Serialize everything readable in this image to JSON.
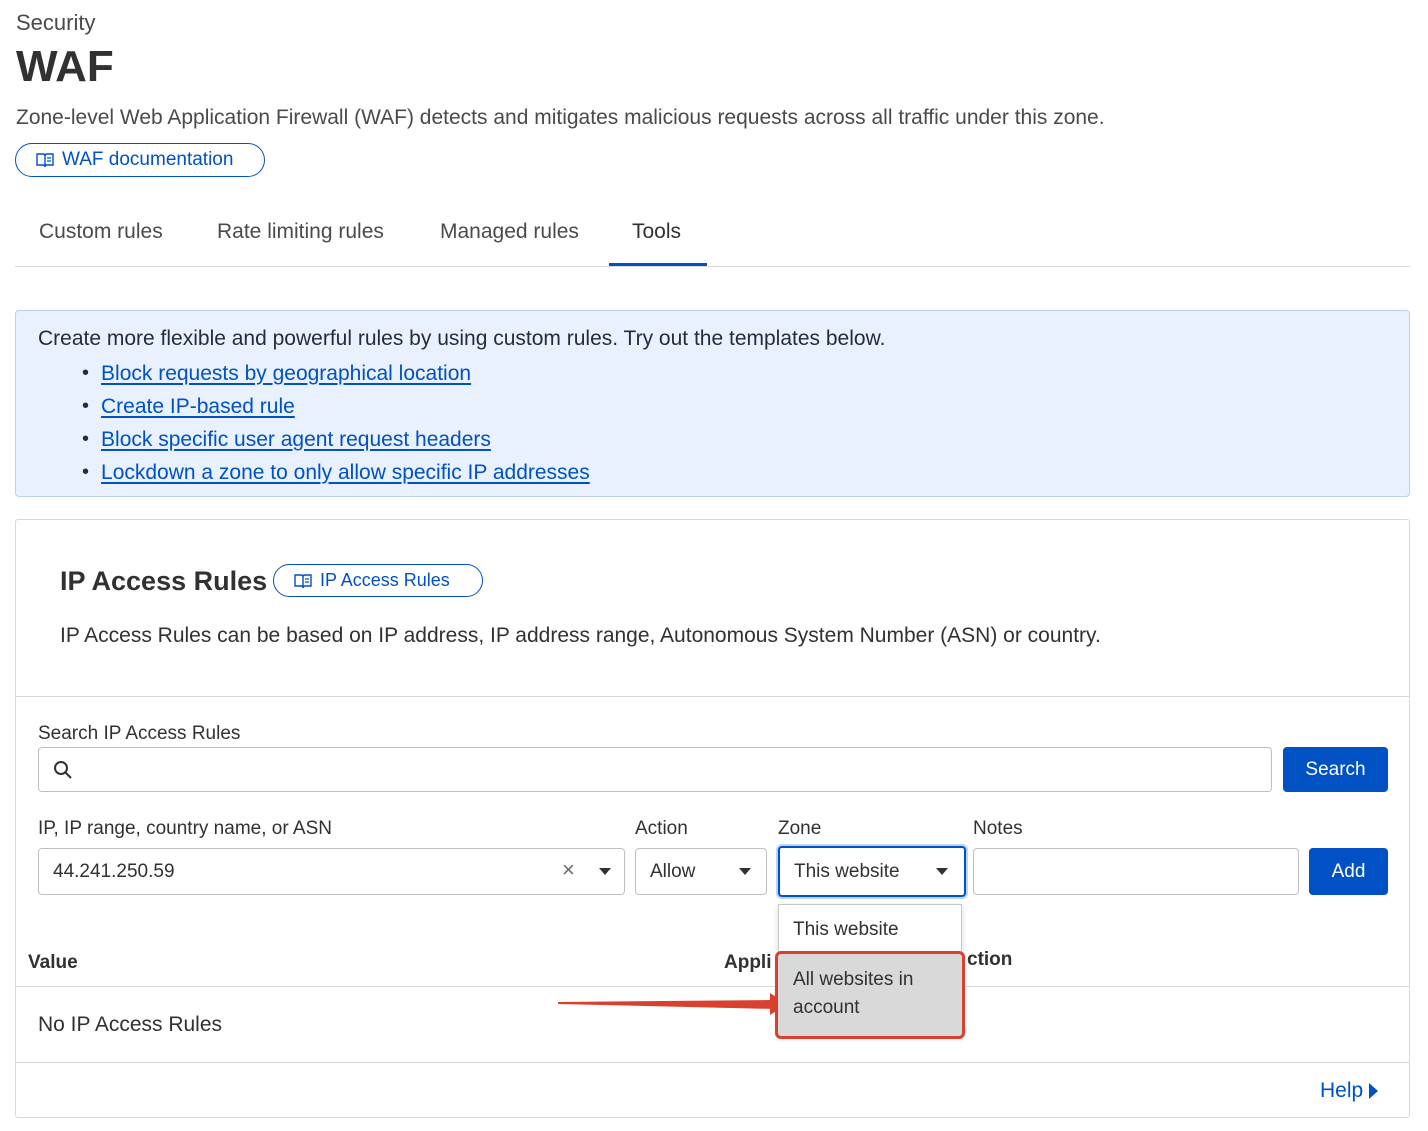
{
  "header": {
    "breadcrumb": "Security",
    "title": "WAF",
    "description": "Zone-level Web Application Firewall (WAF) detects and mitigates malicious requests across all traffic under this zone.",
    "doc_link": "WAF documentation"
  },
  "tabs": [
    {
      "label": "Custom rules"
    },
    {
      "label": "Rate limiting rules"
    },
    {
      "label": "Managed rules"
    },
    {
      "label": "Tools",
      "active": true
    }
  ],
  "info": {
    "text": "Create more flexible and powerful rules by using custom rules. Try out the templates below.",
    "links": [
      "Block requests by geographical location",
      "Create IP-based rule",
      "Block specific user agent request headers",
      "Lockdown a zone to only allow specific IP addresses"
    ]
  },
  "ip_access": {
    "title": "IP Access Rules",
    "doc_link": "IP Access Rules",
    "description": "IP Access Rules can be based on IP address, IP address range, Autonomous System Number (ASN) or country.",
    "search_label": "Search IP Access Rules",
    "search_value": "",
    "search_button": "Search",
    "form": {
      "ip_label": "IP, IP range, country name, or ASN",
      "ip_value": "44.241.250.59",
      "action_label": "Action",
      "action_value": "Allow",
      "zone_label": "Zone",
      "zone_value": "This website",
      "notes_label": "Notes",
      "notes_value": "",
      "add_button": "Add"
    },
    "zone_options": [
      "This website",
      "All websites in account"
    ],
    "table": {
      "columns": [
        "Value",
        "Appli",
        "ction"
      ],
      "empty_text": "No IP Access Rules"
    },
    "help_link": "Help"
  },
  "colors": {
    "accent": "#0051c3",
    "info_bg": "#e8f1fd",
    "highlight": "#d9402e"
  }
}
